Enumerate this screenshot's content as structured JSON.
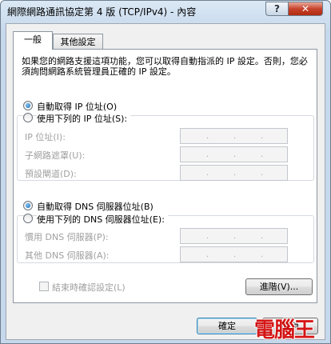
{
  "window": {
    "title": "網際網路通訊協定第 4 版 (TCP/IPv4) - 內容"
  },
  "titlebar": {
    "help_label": "?",
    "close_label": "✕"
  },
  "tabs": [
    {
      "label": "一般"
    },
    {
      "label": "其他設定"
    }
  ],
  "description": "如果您的網路支援這項功能，您可以取得自動指派的 IP 設定。否則，您必須詢問網路系統管理員正確的 IP 設定。",
  "ip": {
    "auto_label": "自動取得 IP 位址(O)",
    "manual_label": "使用下列的 IP 位址(S):",
    "selected": "auto",
    "fields": [
      {
        "label": "IP 位址(I):",
        "value": ""
      },
      {
        "label": "子網路遮罩(U):",
        "value": ""
      },
      {
        "label": "預設閘道(D):",
        "value": ""
      }
    ]
  },
  "dns": {
    "auto_label": "自動取得 DNS 伺服器位址(B)",
    "manual_label": "使用下列的 DNS 伺服器位址(E):",
    "selected": "auto",
    "fields": [
      {
        "label": "慣用 DNS 伺服器(P):",
        "value": ""
      },
      {
        "label": "其他 DNS 伺服器(A):",
        "value": ""
      }
    ]
  },
  "validate_checkbox": {
    "label": "結束時確認設定(L)",
    "checked": false,
    "enabled": false
  },
  "buttons": {
    "advanced": "進階(V)...",
    "ok": "確定",
    "cancel": "取消"
  },
  "watermark": "電腦王",
  "ip_separator": "."
}
